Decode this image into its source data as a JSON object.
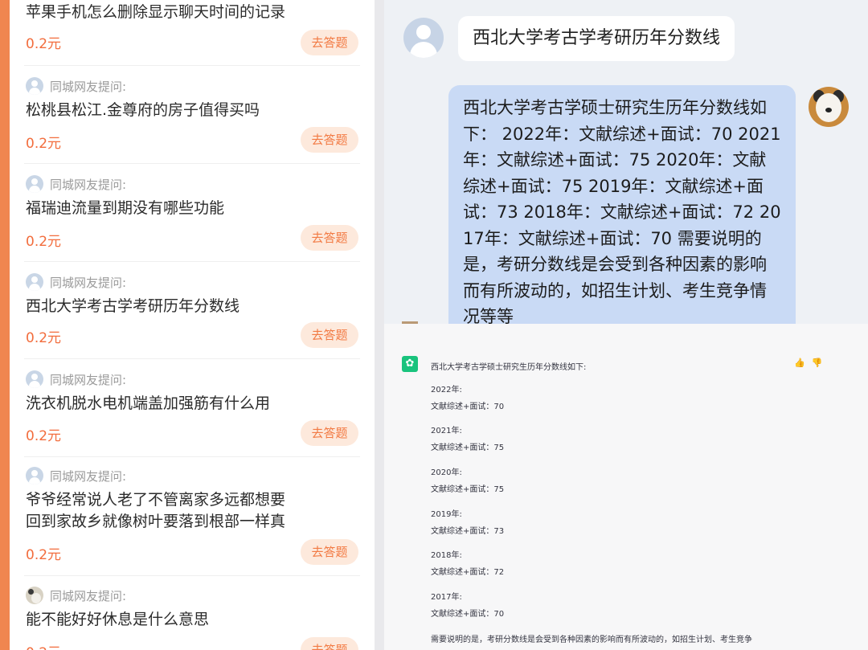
{
  "left_list": {
    "asker_label": "同城网友提问:",
    "price": "0.2元",
    "answer_button": "去答题",
    "first_question": "苹果手机怎么删除显示聊天时间的记录",
    "items": [
      {
        "question": "松桃县松江.金尊府的房子值得买吗"
      },
      {
        "question": "福瑞迪流量到期没有哪些功能"
      },
      {
        "question": "西北大学考古学考研历年分数线"
      },
      {
        "question": "洗衣机脱水电机端盖加强筋有什么用"
      },
      {
        "question": "爷爷经常说人老了不管离家多远都想要回到家故乡就像树叶要落到根部一样真"
      },
      {
        "question": "能不能好好休息是什么意思"
      }
    ]
  },
  "chat": {
    "user_message": "西北大学考古学考研历年分数线",
    "bot_reply": "西北大学考古学硕士研究生历年分数线如下： 2022年：文献综述+面试：70 2021年：文献综述+面试：75 2020年：文献综述+面试：75 2019年：文献综述+面试：73 2018年：文献综述+面试：72 2017年：文献综述+面试：70 需要说明的是，考研分数线是会受到各种因素的影响而有所波动的，如招生计划、考生竞争情况等等"
  },
  "gpt": {
    "intro": "西北大学考古学硕士研究生历年分数线如下:",
    "entries": [
      {
        "year": "2022年:",
        "score": "文献综述+面试：70"
      },
      {
        "year": "2021年:",
        "score": "文献综述+面试：75"
      },
      {
        "year": "2020年:",
        "score": "文献综述+面试：75"
      },
      {
        "year": "2019年:",
        "score": "文献综述+面试：73"
      },
      {
        "year": "2018年:",
        "score": "文献综述+面试：72"
      },
      {
        "year": "2017年:",
        "score": "文献综述+面试：70"
      }
    ],
    "note": "需要说明的是，考研分数线是会受到各种因素的影响而有所波动的，如招生计划、考生竞争",
    "icons": [
      "openai-logo-icon",
      "thumbs-up-icon",
      "thumbs-down-icon"
    ]
  },
  "colors": {
    "frame_orange": "#f08650",
    "price_red": "#f26d3d",
    "button_bg": "#fde9dc",
    "bot_bubble": "#c9daf5",
    "gpt_green": "#19c37d"
  }
}
